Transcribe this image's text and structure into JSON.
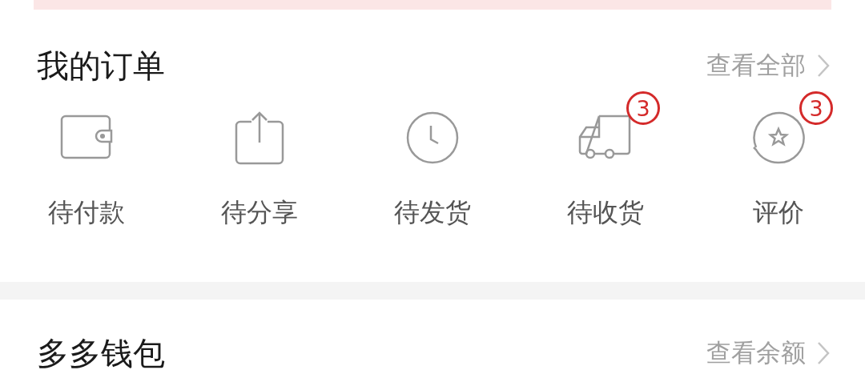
{
  "orders": {
    "title": "我的订单",
    "link": "查看全部",
    "items": [
      {
        "kind": "wallet",
        "label": "待付款"
      },
      {
        "kind": "share",
        "label": "待分享"
      },
      {
        "kind": "clock",
        "label": "待发货"
      },
      {
        "kind": "truck",
        "label": "待收货",
        "badge": "3"
      },
      {
        "kind": "review",
        "label": "评价",
        "badge": "3"
      }
    ]
  },
  "wallet": {
    "title": "多多钱包",
    "link": "查看余额"
  }
}
